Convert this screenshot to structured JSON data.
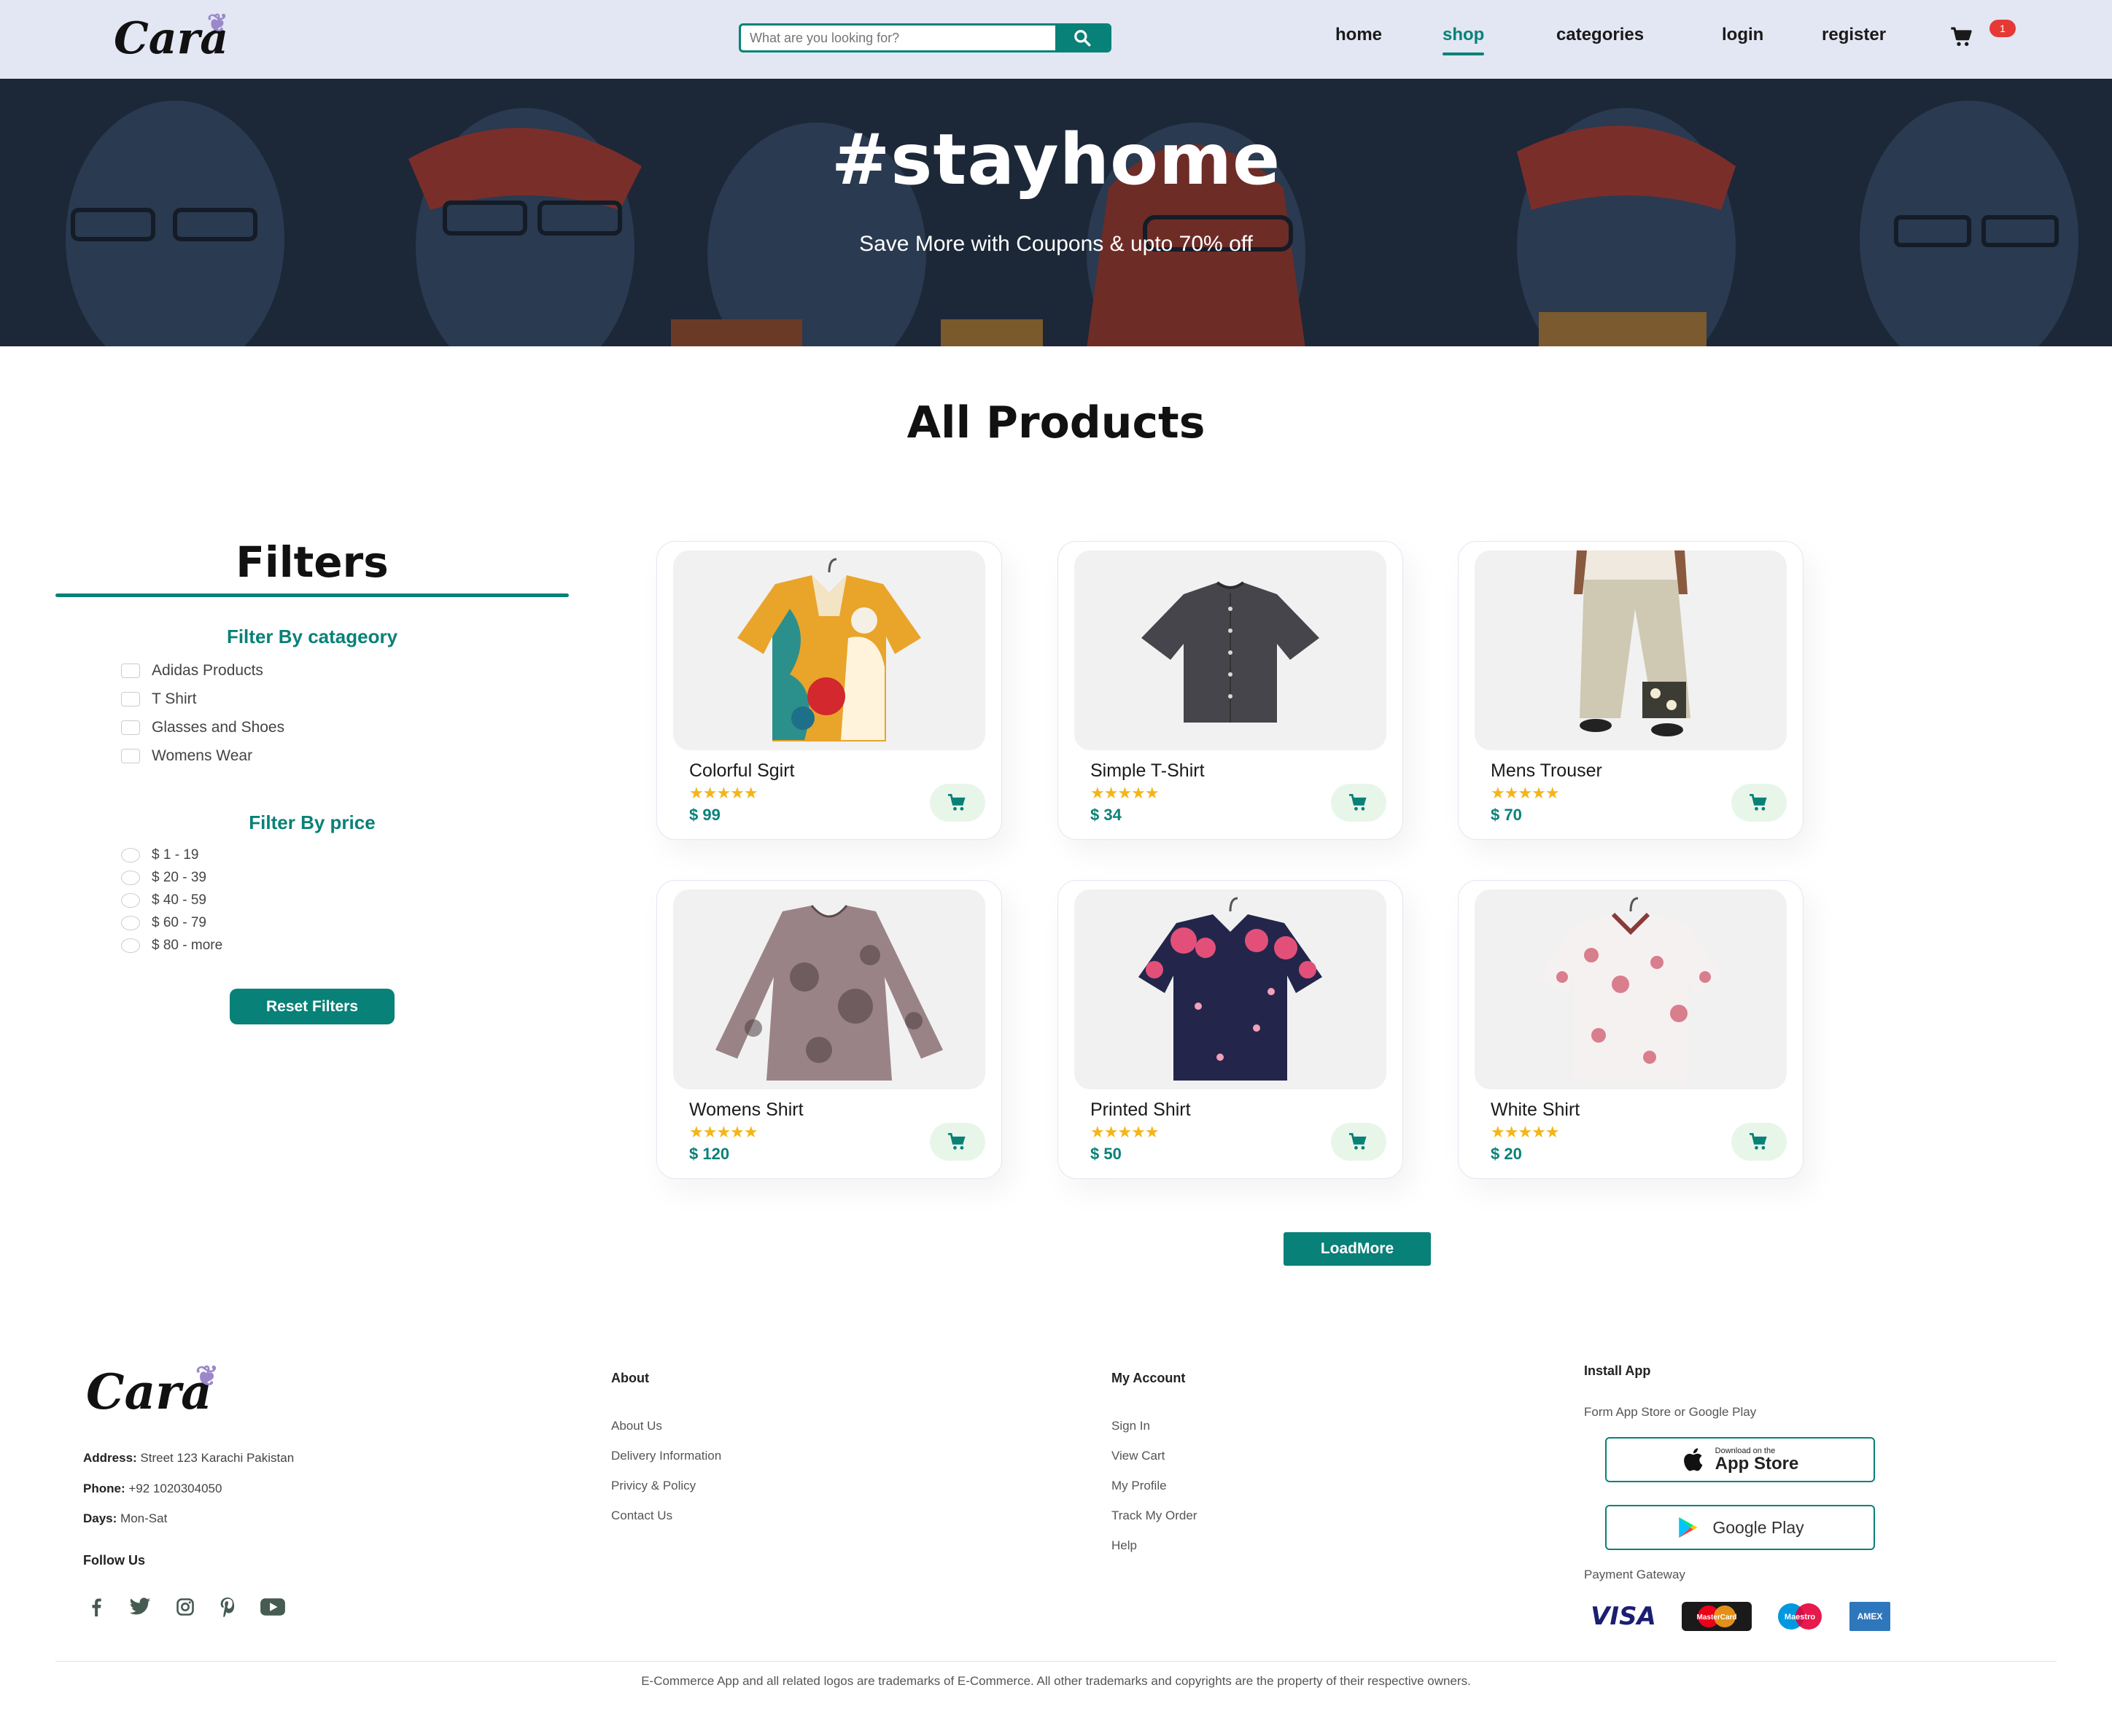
{
  "brand": {
    "name": "Cara"
  },
  "header": {
    "search_placeholder": "What are you looking for?",
    "nav": [
      {
        "label": "home",
        "active": false
      },
      {
        "label": "shop",
        "active": true
      },
      {
        "label": "categories",
        "active": false
      },
      {
        "label": "login",
        "active": false
      },
      {
        "label": "register",
        "active": false
      }
    ],
    "cart_count": "1"
  },
  "hero": {
    "title": "#stayhome",
    "subtitle": "Save More with Coupons & upto 70% off"
  },
  "main": {
    "title": "All Products"
  },
  "filters": {
    "title": "Filters",
    "category_heading": "Filter By catageory",
    "categories": [
      "Adidas Products",
      "T Shirt",
      "Glasses and Shoes",
      "Womens Wear"
    ],
    "price_heading": "Filter By price",
    "prices": [
      "$ 1 - 19",
      "$ 20 - 39",
      "$ 40 - 59",
      "$ 60 - 79",
      "$ 80 - more"
    ],
    "reset_label": "Reset Filters"
  },
  "products": [
    {
      "name": "Colorful Sgirt",
      "rating": 5,
      "price": "$ 99"
    },
    {
      "name": "Simple T-Shirt",
      "rating": 5,
      "price": "$ 34"
    },
    {
      "name": "Mens Trouser",
      "rating": 5,
      "price": "$ 70"
    },
    {
      "name": "Womens Shirt",
      "rating": 5,
      "price": "$ 120"
    },
    {
      "name": "Printed Shirt",
      "rating": 5,
      "price": "$ 50"
    },
    {
      "name": "White Shirt",
      "rating": 5,
      "price": "$ 20"
    }
  ],
  "load_more_label": "LoadMore",
  "footer": {
    "contact": {
      "address_label": "Address:",
      "address": "Street 123 Karachi Pakistan",
      "phone_label": "Phone:",
      "phone": "+92 1020304050",
      "days_label": "Days:",
      "days": "Mon-Sat"
    },
    "follow_label": "Follow Us",
    "social_icons": [
      "facebook-icon",
      "twitter-icon",
      "instagram-icon",
      "pinterest-icon",
      "youtube-icon"
    ],
    "about": {
      "heading": "About",
      "links": [
        "About Us",
        "Delivery Information",
        "Privicy & Policy",
        "Contact Us"
      ]
    },
    "account": {
      "heading": "My Account",
      "links": [
        "Sign In",
        "View Cart",
        "My Profile",
        "Track My Order",
        "Help"
      ]
    },
    "install": {
      "heading": "Install App",
      "subtext": "Form App Store or Google Play",
      "app_store_small": "Download on the",
      "app_store_big": "App Store",
      "google_play": "Google Play",
      "payment_heading": "Payment Gateway",
      "payments": [
        "VISA",
        "MasterCard",
        "Maestro",
        "AMEX"
      ]
    },
    "copyright": "E-Commerce App and all related logos are trademarks of E-Commerce. All other trademarks and copyrights are the property of their respective owners."
  },
  "colors": {
    "accent": "#088178",
    "header_bg": "#e3e6f3",
    "star": "#f3b519",
    "badge": "#e53935"
  }
}
